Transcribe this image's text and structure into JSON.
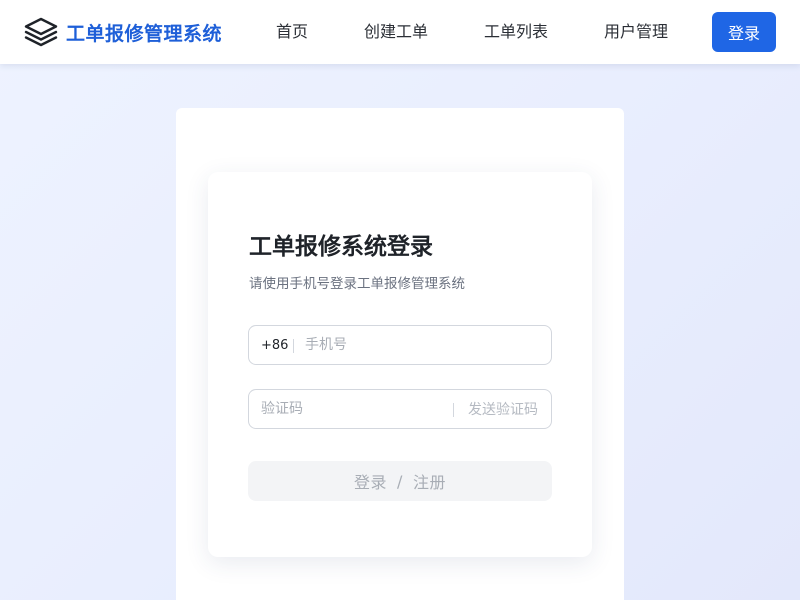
{
  "nav": {
    "logo_icon": "layers-icon",
    "brand_title": "工单报修管理系统",
    "links": [
      "首页",
      "创建工单",
      "工单列表",
      "用户管理"
    ],
    "login_button": "登录",
    "brand_color": "#1e5fd8",
    "accent_color": "#1f66e5"
  },
  "login_form": {
    "title": "工单报修系统登录",
    "subtitle": "请使用手机号登录工单报修管理系统",
    "phone_prefix": "+86",
    "phone_placeholder": "手机号",
    "phone_value": "",
    "code_placeholder": "验证码",
    "code_value": "",
    "send_code_label": "发送验证码",
    "submit_login_label": "登录",
    "submit_separator": "/",
    "submit_register_label": "注册"
  }
}
